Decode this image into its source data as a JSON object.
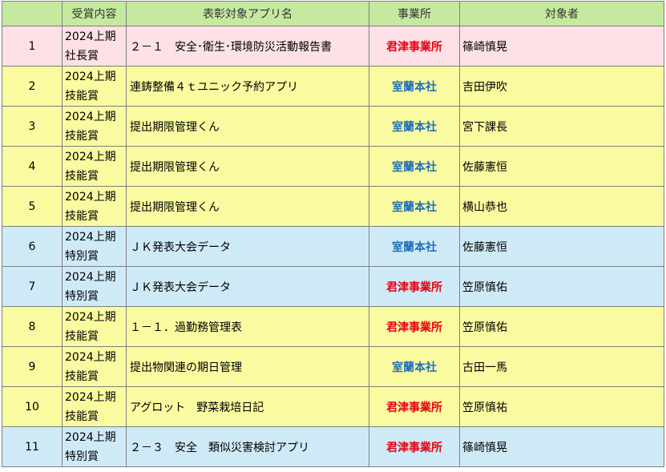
{
  "headers": {
    "no": "",
    "award": "受賞内容",
    "app": "表彰対象アプリ名",
    "office": "事業所",
    "person": "対象者"
  },
  "colors": {
    "header_bg": "#c6e9a0",
    "pink_row": "#fde1e6",
    "yellow_row": "#fafaa0",
    "blue_row": "#cfeaf7",
    "red_text": "#e60012",
    "blue_text": "#1f6fb8"
  },
  "rows": [
    {
      "no": "1",
      "award_period": "2024上期",
      "award_type": "社長賞",
      "app": "２－１　安全･衛生･環境防災活動報告書",
      "office": "君津事業所",
      "person": "篠崎慎晃"
    },
    {
      "no": "2",
      "award_period": "2024上期",
      "award_type": "技能賞",
      "app": "連鋳整備４ｔユニック予約アプリ",
      "office": "室蘭本社",
      "person": "吉田伊吹"
    },
    {
      "no": "3",
      "award_period": "2024上期",
      "award_type": "技能賞",
      "app": "提出期限管理くん",
      "office": "室蘭本社",
      "person": "宮下課長"
    },
    {
      "no": "4",
      "award_period": "2024上期",
      "award_type": "技能賞",
      "app": "提出期限管理くん",
      "office": "室蘭本社",
      "person": "佐藤憲恒"
    },
    {
      "no": "5",
      "award_period": "2024上期",
      "award_type": "技能賞",
      "app": "提出期限管理くん",
      "office": "室蘭本社",
      "person": "横山恭也"
    },
    {
      "no": "6",
      "award_period": "2024上期",
      "award_type": "特別賞",
      "app": "ＪＫ発表大会データ",
      "office": "室蘭本社",
      "person": "佐藤憲恒"
    },
    {
      "no": "7",
      "award_period": "2024上期",
      "award_type": "特別賞",
      "app": "ＪＫ発表大会データ",
      "office": "君津事業所",
      "person": "笠原慎佑"
    },
    {
      "no": "8",
      "award_period": "2024上期",
      "award_type": "技能賞",
      "app": "１－１．過勤務管理表",
      "office": "君津事業所",
      "person": "笠原慎佑"
    },
    {
      "no": "9",
      "award_period": "2024上期",
      "award_type": "技能賞",
      "app": "提出物関連の期日管理",
      "office": "室蘭本社",
      "person": "古田一馬"
    },
    {
      "no": "10",
      "award_period": "2024上期",
      "award_type": "技能賞",
      "app": "アグロット　野菜栽培日記",
      "office": "君津事業所",
      "person": "笠原慎祐"
    },
    {
      "no": "11",
      "award_period": "2024上期",
      "award_type": "特別賞",
      "app": "２－３　安全　類似災害検討アプリ",
      "office": "君津事業所",
      "person": "篠崎慎晃"
    }
  ]
}
